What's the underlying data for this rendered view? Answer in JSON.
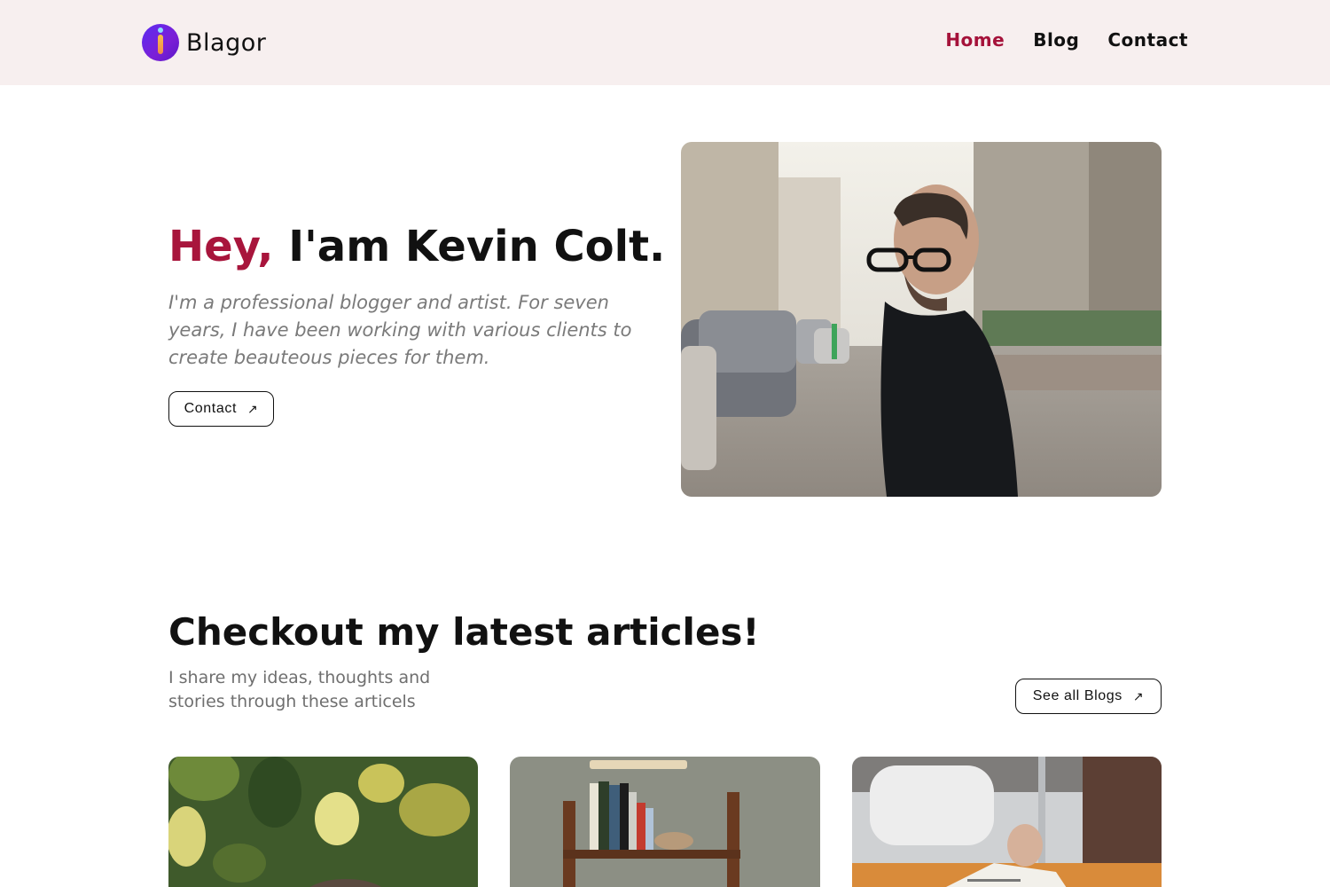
{
  "brand": {
    "name": "Blagor",
    "icon": "logo-i-icon"
  },
  "nav": {
    "items": [
      {
        "label": "Home",
        "active": true
      },
      {
        "label": "Blog",
        "active": false
      },
      {
        "label": "Contact",
        "active": false
      }
    ]
  },
  "hero": {
    "greeting": "Hey,",
    "title_rest": " I'am Kevin Colt.",
    "subtitle": "I'm a professional blogger and artist. For seven years, I have been working with various clients to create beauteous pieces for them.",
    "cta_label": "Contact",
    "cta_icon": "arrow-up-right-icon",
    "photo_alt": "man-in-turtleneck-photo"
  },
  "articles": {
    "title": "Checkout my latest articles!",
    "subtitle": "I share my ideas, thoughts and stories through these articels",
    "see_all_label": "See all Blogs",
    "see_all_icon": "arrow-up-right-icon"
  },
  "colors": {
    "accent": "#a8153c",
    "header_bg": "#f7efef",
    "muted_text": "#7a7a7a"
  }
}
